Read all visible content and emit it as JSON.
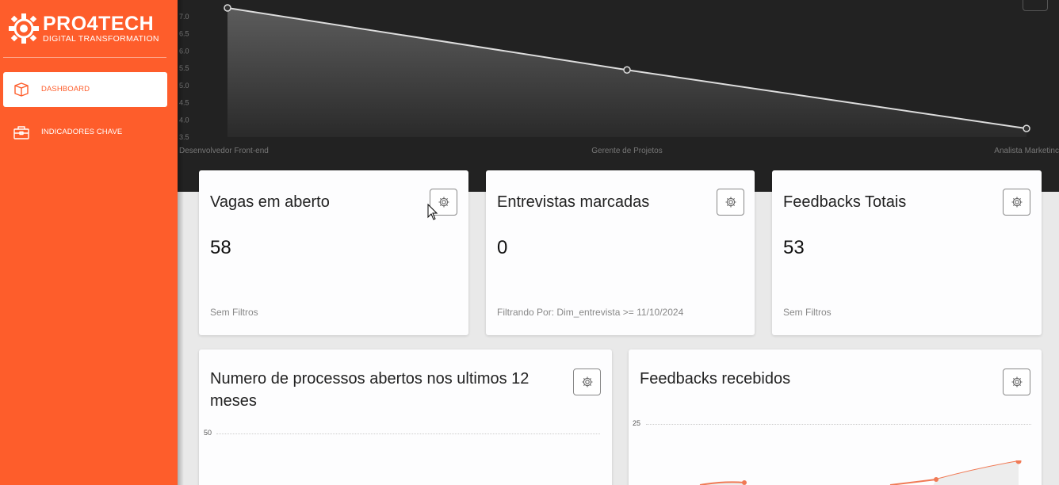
{
  "brand": {
    "title": "PRO4TECH",
    "subtitle": "DIGITAL TRANSFORMATION",
    "accent": "#fe5d2b"
  },
  "sidebar": {
    "items": [
      {
        "label": "DASHBOARD",
        "icon": "box-icon",
        "active": true
      },
      {
        "label": "INDICADORES CHAVE",
        "icon": "briefcase-icon",
        "active": false
      }
    ]
  },
  "hero_chart": {
    "chart_data": {
      "type": "area",
      "categories": [
        "Desenvolvedor Front-end",
        "Gerente de Projetos",
        "Analista Marketing"
      ],
      "category_labels_shown": [
        "Desenvolvedor Front-end",
        "Gerente de Projetos",
        "Analista Marketinc"
      ],
      "values": [
        7.25,
        5.45,
        3.75
      ],
      "y_ticks": [
        "7.0",
        "6.5",
        "6.0",
        "5.5",
        "5.0",
        "4.5",
        "4.0",
        "3.5"
      ],
      "ylim": [
        3.5,
        7.25
      ]
    }
  },
  "cards": [
    {
      "title": "Vagas em aberto",
      "value": "58",
      "filter": "Sem Filtros"
    },
    {
      "title": "Entrevistas marcadas",
      "value": "0",
      "filter": "Filtrando Por: Dim_entrevista >= 11/10/2024"
    },
    {
      "title": "Feedbacks Totais",
      "value": "53",
      "filter": "Sem Filtros"
    }
  ],
  "bottom_cards": [
    {
      "title": "Numero de processos abertos nos ultimos 12 meses",
      "y_tick": "50"
    },
    {
      "title": "Feedbacks recebidos",
      "y_tick": "25"
    }
  ]
}
